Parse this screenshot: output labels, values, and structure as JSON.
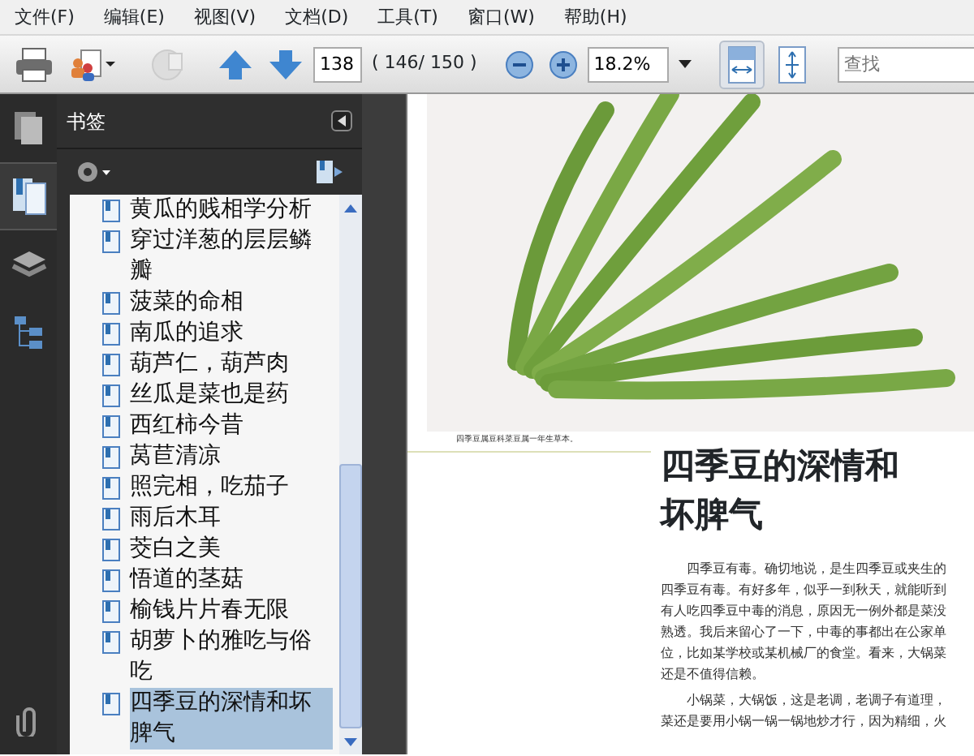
{
  "menu": [
    "文件(F)",
    "编辑(E)",
    "视图(V)",
    "文档(D)",
    "工具(T)",
    "窗口(W)",
    "帮助(H)"
  ],
  "toolbar": {
    "page_number": "138",
    "page_count": "( 146/ 150 )",
    "zoom": "18.2%",
    "fit_width_selected": true,
    "fit_page_selected": false,
    "search_placeholder": "查找"
  },
  "nav_tabs": [
    {
      "kind": "pages",
      "selected": false
    },
    {
      "kind": "bookmarks",
      "selected": true
    },
    {
      "kind": "layers",
      "selected": false
    },
    {
      "kind": "structure",
      "selected": false
    }
  ],
  "panel": {
    "title": "书签"
  },
  "bookmarks": [
    {
      "label": "黄瓜的贱相学分析",
      "selected": false
    },
    {
      "label": "穿过洋葱的层层鳞瓣",
      "selected": false
    },
    {
      "label": "菠菜的命相",
      "selected": false
    },
    {
      "label": "南瓜的追求",
      "selected": false
    },
    {
      "label": "葫芦仁，葫芦肉",
      "selected": false
    },
    {
      "label": "丝瓜是菜也是药",
      "selected": false
    },
    {
      "label": "西红柿今昔",
      "selected": false
    },
    {
      "label": "莴苣清凉",
      "selected": false
    },
    {
      "label": "照完相，吃茄子",
      "selected": false
    },
    {
      "label": "雨后木耳",
      "selected": false
    },
    {
      "label": "茭白之美",
      "selected": false
    },
    {
      "label": "悟道的茎菇",
      "selected": false
    },
    {
      "label": "榆钱片片春无限",
      "selected": false
    },
    {
      "label": "胡萝卜的雅吃与俗吃",
      "selected": false
    },
    {
      "label": "四季豆的深情和坏脾气",
      "selected": true
    }
  ],
  "document": {
    "caption": "四季豆属豆科菜豆属一年生草本。",
    "title": "四季豆的深情和坏脾气",
    "paragraphs": [
      "四季豆有毒。确切地说，是生四季豆或夹生的四季豆有毒。有好多年，似乎一到秋天，就能听到有人吃四季豆中毒的消息，原因无一例外都是菜没熟透。我后来留心了一下，中毒的事都出在公家单位，比如某学校或某机械厂的食堂。看来，大锅菜还是不值得信赖。",
      "小锅菜，大锅饭，这是老调，老调子有道理，菜还是要用小锅一锅一锅地炒才行，因为精细，火"
    ]
  }
}
